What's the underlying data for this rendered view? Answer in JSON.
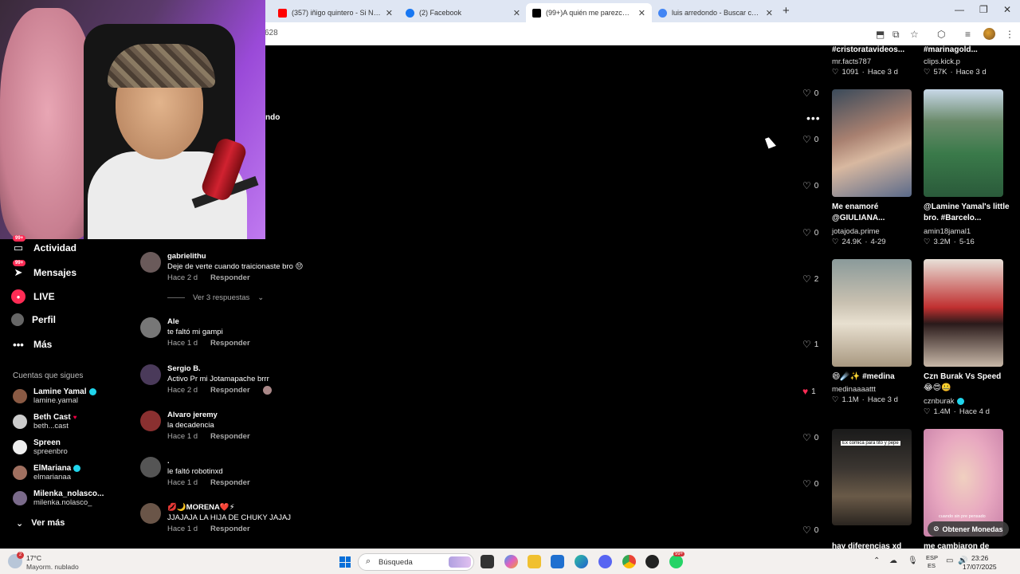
{
  "browser": {
    "tabs": [
      {
        "title": "(357) iñigo quintero - Si No Esta",
        "favicon_color": "#ff0000",
        "active": false
      },
      {
        "title": "(2) Facebook",
        "favicon_color": "#1877f2",
        "active": false
      },
      {
        "title": "(99+)A quién me parezco más:",
        "favicon_color": "#000000",
        "active": true
      },
      {
        "title": "luis arredondo - Buscar con Goo",
        "favicon_color": "#4285f4",
        "active": false
      }
    ],
    "new_tab": "+",
    "address_fragment": "628"
  },
  "sidebar": {
    "nav": [
      {
        "label": "Actividad",
        "badge": "99+"
      },
      {
        "label": "Mensajes",
        "badge": "99+"
      },
      {
        "label": "LIVE"
      },
      {
        "label": "Perfil"
      },
      {
        "label": "Más"
      }
    ],
    "following_title": "Cuentas que sigues",
    "following": [
      {
        "name": "Lamine Yamal",
        "handle": "lamine.yamal",
        "verified": true
      },
      {
        "name": "Beth Cast",
        "handle": "beth...cast",
        "verified": false
      },
      {
        "name": "Spreen",
        "handle": "spreenbro",
        "verified": false
      },
      {
        "name": "ElMariana",
        "handle": "elmarianaa",
        "verified": true
      },
      {
        "name": "Milenka_nolasco...",
        "handle": "milenka.nolasco_",
        "verified": false
      }
    ],
    "see_more": "Ver más"
  },
  "partial_text": "ndo",
  "comments": [
    {
      "user": "gabrielithu",
      "text": "Deje de verte cuando traicionaste bro 😔",
      "time": "Hace 2 d",
      "reply": "Responder"
    },
    {
      "user": "Ale",
      "text": "te faltó mi gampi",
      "time": "Hace 1 d",
      "reply": "Responder"
    },
    {
      "user": "Sergio B.",
      "text": "Activo Pr mi Jotamapache brrr",
      "time": "Hace 2 d",
      "reply": "Responder"
    },
    {
      "user": "Alvaro jeremy",
      "text": "la decadencia",
      "time": "Hace 1 d",
      "reply": "Responder"
    },
    {
      "user": ".",
      "text": "le faltó robotinxd",
      "time": "Hace 1 d",
      "reply": "Responder"
    },
    {
      "user": "💋🌙MORENA❤️⚡",
      "text": "JJAJAJA LA HIJA DE CHUKY JAJAJ",
      "time": "Hace 1 d",
      "reply": "Responder"
    }
  ],
  "view_replies": "Ver 3 respuestas",
  "likes": [
    "0",
    "0",
    "0",
    "0",
    "0",
    "2",
    "1",
    "1",
    "0",
    "0",
    "0"
  ],
  "videos": [
    {
      "title": "#cristoratavideos...",
      "author": "mr.facts787",
      "views": "1091",
      "date": "Hace 3 d"
    },
    {
      "title": "#marinagold...",
      "author": "clips.kick.p",
      "views": "57K",
      "date": "Hace 3 d"
    },
    {
      "title": "Me enamoré @GIULIANA...",
      "author": "jotajoda.prime",
      "views": "24.9K",
      "date": "4-29"
    },
    {
      "title": "@Lamine Yamal's little bro. #Barcelo...",
      "author": "amin18jamal1",
      "views": "3.2M",
      "date": "5-16"
    },
    {
      "title": "😄☄️✨ #medina",
      "author": "medinaaaattt",
      "views": "1.1M",
      "date": "Hace 3 d"
    },
    {
      "title": "Czn Burak Vs Speed 😂😍🤐",
      "author": "cznburak",
      "views": "1.4M",
      "date": "Hace 4 d"
    },
    {
      "title": "hay diferencias xd",
      "author": "",
      "views": "",
      "date": ""
    },
    {
      "title": "me cambiaron de",
      "author": "",
      "views": "",
      "date": ""
    }
  ],
  "thumb_caption": "Ex comica para tito y pepe",
  "thumb_caption2": "cuando sin pre pensado",
  "coins_label": "Obtener Monedas",
  "taskbar": {
    "weather_badge": "2",
    "temp": "17°C",
    "weather": "Mayorm. nublado",
    "search_placeholder": "Búsqueda",
    "lang_top": "ESP",
    "lang_bottom": "ES",
    "time": "23:26",
    "date": "17/07/2025",
    "notif_badge": "99+"
  }
}
